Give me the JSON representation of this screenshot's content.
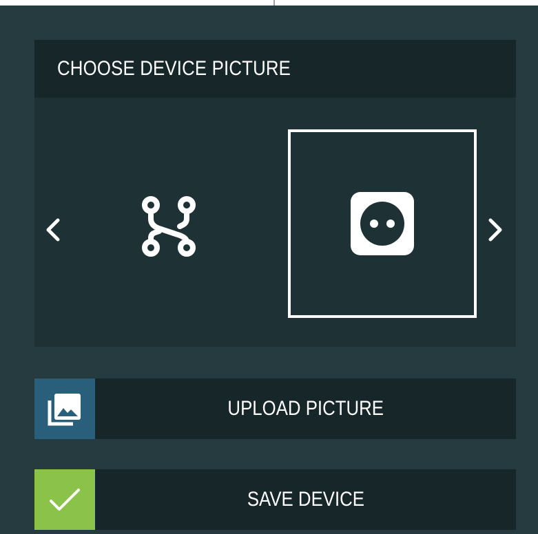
{
  "picker": {
    "title": "CHOOSE DEVICE PICTURE",
    "options": [
      {
        "icon": "circuit-icon",
        "selected": false
      },
      {
        "icon": "power-socket-icon",
        "selected": true
      }
    ],
    "prev_icon": "chevron-left-icon",
    "next_icon": "chevron-right-icon"
  },
  "upload": {
    "label": "UPLOAD PICTURE",
    "icon": "image-gallery-icon",
    "color": "#2a5f7c"
  },
  "save": {
    "label": "SAVE DEVICE",
    "icon": "check-icon",
    "color": "#8bc34a"
  },
  "colors": {
    "panel_background": "#253b3f",
    "picker_background": "#1e3236",
    "header_background": "#172629",
    "text": "#ffffff"
  }
}
